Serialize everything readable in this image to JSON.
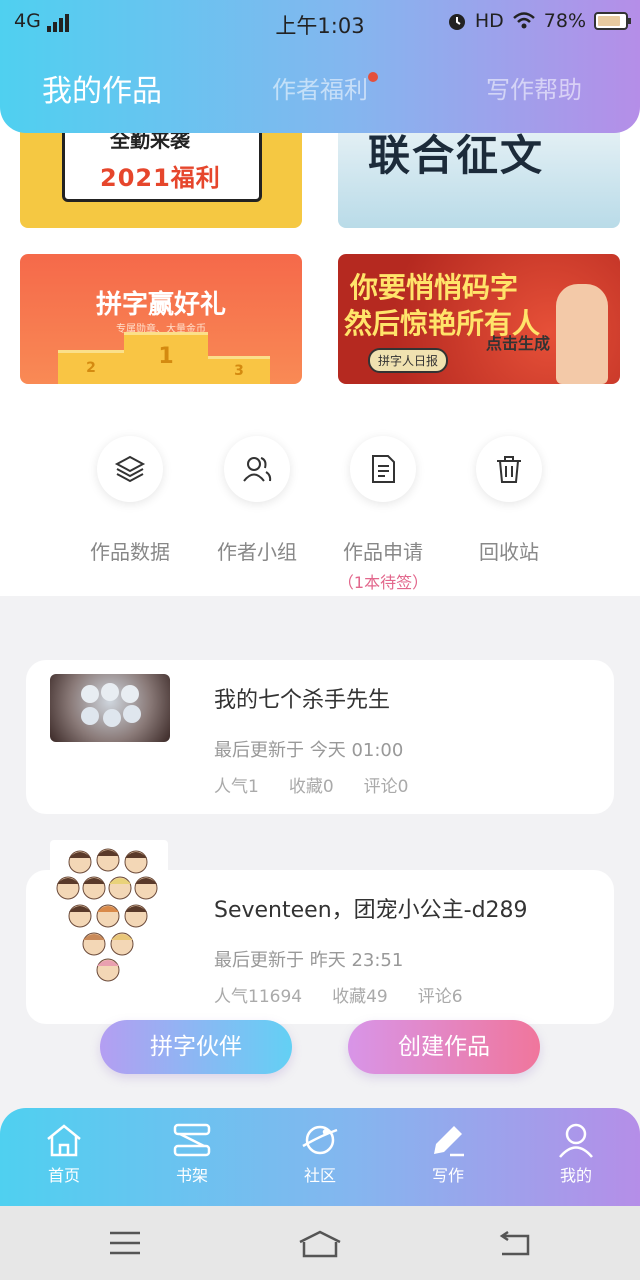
{
  "status_bar": {
    "network": "4G",
    "time": "上午1:03",
    "hd": "HD",
    "battery": "78%"
  },
  "header": {
    "tabs": [
      {
        "label": "我的作品",
        "active": true
      },
      {
        "label": "作者福利",
        "active": false,
        "badge": true
      },
      {
        "label": "写作帮助",
        "active": false
      }
    ]
  },
  "banners": {
    "b1": {
      "title": "全勤来袭",
      "subtitle": "2021福利"
    },
    "b2": {
      "title": "联合征文"
    },
    "b3": {
      "title": "拼字赢好礼",
      "subtitle": "专属勋章、大量金币",
      "podium": [
        "2",
        "1",
        "3"
      ]
    },
    "b4": {
      "line1": "你要悄悄码字",
      "line2": "然后惊艳所有人",
      "pill": "拼字人日报",
      "cta": "点击生成"
    }
  },
  "actions": [
    {
      "label": "作品数据",
      "icon": "layers-icon"
    },
    {
      "label": "作者小组",
      "icon": "group-icon"
    },
    {
      "label": "作品申请",
      "icon": "document-icon",
      "sub": "（1本待签）"
    },
    {
      "label": "回收站",
      "icon": "trash-icon"
    }
  ],
  "works": [
    {
      "title": "我的七个杀手先生",
      "updated": "最后更新于 今天 01:00",
      "popularity": "人气1",
      "favorites": "收藏0",
      "comments": "评论0"
    },
    {
      "title": "Seventeen，团宠小公主-d289",
      "updated": "最后更新于 昨天 23:51",
      "popularity": "人气11694",
      "favorites": "收藏49",
      "comments": "评论6"
    }
  ],
  "buttons": {
    "partner": "拼字伙伴",
    "create": "创建作品"
  },
  "nav": [
    {
      "label": "首页",
      "icon": "home-icon"
    },
    {
      "label": "书架",
      "icon": "bookshelf-icon"
    },
    {
      "label": "社区",
      "icon": "planet-icon"
    },
    {
      "label": "写作",
      "icon": "pen-icon"
    },
    {
      "label": "我的",
      "icon": "user-icon"
    }
  ],
  "colors": {
    "gradient_start": "#4fd0f0",
    "gradient_end": "#b58ee8",
    "accent_pink": "#e2678c",
    "badge_red": "#e4503c"
  }
}
